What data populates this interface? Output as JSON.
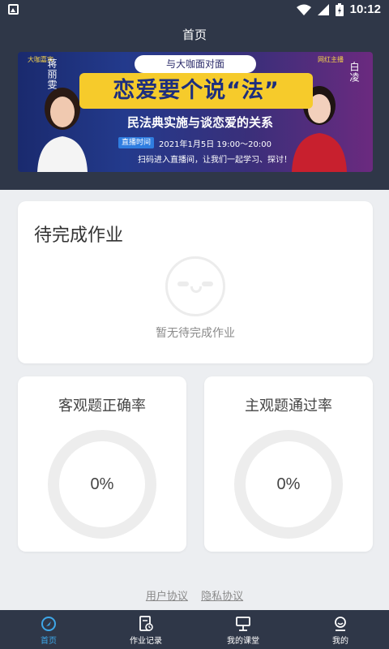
{
  "status_bar": {
    "time": "10:12"
  },
  "header": {
    "title": "首页"
  },
  "banner": {
    "top_text": "与大咖面对面",
    "main_title": "恋爱要个说“法”",
    "sub_title": "民法典实施与谈恋爱的关系",
    "time_tag": "直播时间",
    "time_text": "2021年1月5日  19:00～20:00",
    "invite": "扫码进入直播间，让我们一起学习、探讨！",
    "host_left_name": "蒋丽雯",
    "host_left_tag": "大咖嘉宾",
    "host_right_name": "白凌",
    "host_right_tag": "网红主播"
  },
  "todo": {
    "title": "待完成作业",
    "empty_text": "暂无待完成作业"
  },
  "stats": [
    {
      "title": "客观题正确率",
      "value": "0%"
    },
    {
      "title": "主观题通过率",
      "value": "0%"
    }
  ],
  "links": {
    "user_agreement": "用户协议",
    "privacy": "隐私协议"
  },
  "tabs": [
    {
      "label": "首页",
      "icon": "home-icon",
      "active": true
    },
    {
      "label": "作业记录",
      "icon": "homework-record-icon",
      "active": false
    },
    {
      "label": "我的课堂",
      "icon": "classroom-icon",
      "active": false
    },
    {
      "label": "我的",
      "icon": "profile-icon",
      "active": false
    }
  ],
  "colors": {
    "header_bg": "#2f3748",
    "accent": "#3ea7e8",
    "page_bg": "#eceef1"
  }
}
